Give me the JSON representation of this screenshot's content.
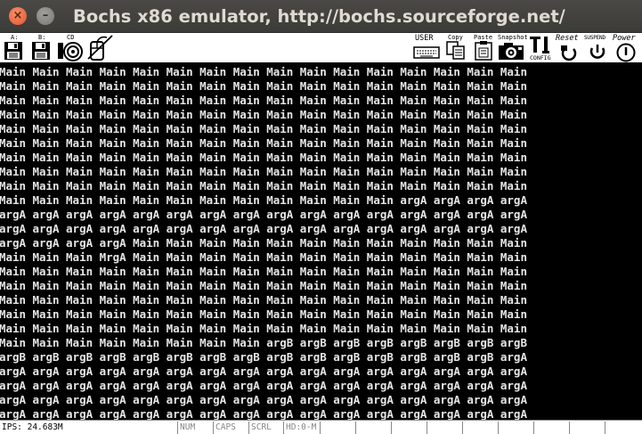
{
  "window": {
    "title": "Bochs x86 emulator, http://bochs.sourceforge.net/",
    "close_glyph": "×",
    "minimize_glyph": "–"
  },
  "toolbar": {
    "floppy_a_label": "A:",
    "floppy_b_label": "B:",
    "cdrom_label": "CD",
    "user_label": "USER",
    "copy_label": "Copy",
    "paste_label": "Paste",
    "snapshot_label": "Snapshot",
    "config_label": "CONFIG",
    "reset_label": "Reset",
    "suspend_label": "SUSPEND",
    "power_label": "Power"
  },
  "screen": {
    "lines": [
      "Main Main Main Main Main Main Main Main Main Main Main Main Main Main Main Main",
      "Main Main Main Main Main Main Main Main Main Main Main Main Main Main Main Main",
      "Main Main Main Main Main Main Main Main Main Main Main Main Main Main Main Main",
      "Main Main Main Main Main Main Main Main Main Main Main Main Main Main Main Main",
      "Main Main Main Main Main Main Main Main Main Main Main Main Main Main Main Main",
      "Main Main Main Main Main Main Main Main Main Main Main Main Main Main Main Main",
      "Main Main Main Main Main Main Main Main Main Main Main Main Main Main Main Main",
      "Main Main Main Main Main Main Main Main Main Main Main Main Main Main Main Main",
      "Main Main Main Main Main Main Main Main Main Main Main Main Main Main Main Main",
      "Main Main Main Main Main Main Main Main Main Main Main Main argA argA argA argA",
      "argA argA argA argA argA argA argA argA argA argA argA argA argA argA argA argA",
      "argA argA argA argA argA argA argA argA argA argA argA argA argA argA argA argA",
      "argA argA argA argA Main Main Main Main Main Main Main Main Main Main Main Main",
      "Main Main Main MrgA Main Main Main Main Main Main Main Main Main Main Main Main",
      "Main Main Main Main Main Main Main Main Main Main Main Main Main Main Main Main",
      "Main Main Main Main Main Main Main Main Main Main Main Main Main Main Main Main",
      "Main Main Main Main Main Main Main Main Main Main Main Main Main Main Main Main",
      "Main Main Main Main Main Main Main Main Main Main Main Main Main Main Main Main",
      "Main Main Main Main Main Main Main Main Main Main Main Main Main Main Main Main",
      "Main Main Main Main Main Main Main Main argB argB argB argB argB argB argB argB",
      "argB argB argB argB argB argB argB argB argB argB argB argB argB argB argB argA",
      "argA argA argA argA argA argA argA argA argA argA argA argA argA argA argA argA",
      "argA argA argA argA argA argA argA argA argA argA argA argA argA argA argA argA",
      "argA argA argA argA argA argA argA argA argA argA argA argA argA argA argA argA",
      "argA argA argA argA argA argA argA argA argA argA argA argA argA argA argA argA"
    ]
  },
  "statusbar": {
    "ips": "IPS: 24.683M",
    "num": "NUM",
    "caps": "CAPS",
    "scrl": "SCRL",
    "hd": "HD:0-M"
  }
}
